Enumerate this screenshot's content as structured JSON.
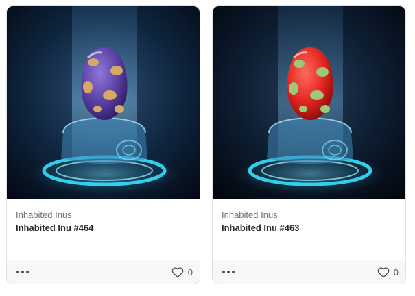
{
  "cards": [
    {
      "collection": "Inhabited Inus",
      "token_name": "Inhabited Inu #464",
      "like_count": "0",
      "egg_color": "#5b3fa3",
      "egg_spot_color": "#d6a86a",
      "background_tint": "#0a2236"
    },
    {
      "collection": "Inhabited Inus",
      "token_name": "Inhabited Inu #463",
      "like_count": "0",
      "egg_color": "#e0241f",
      "egg_spot_color": "#9ec77a",
      "background_tint": "#0b1a2a"
    }
  ],
  "icons": {
    "more": "more-horizontal-icon",
    "like": "heart-outline-icon"
  }
}
